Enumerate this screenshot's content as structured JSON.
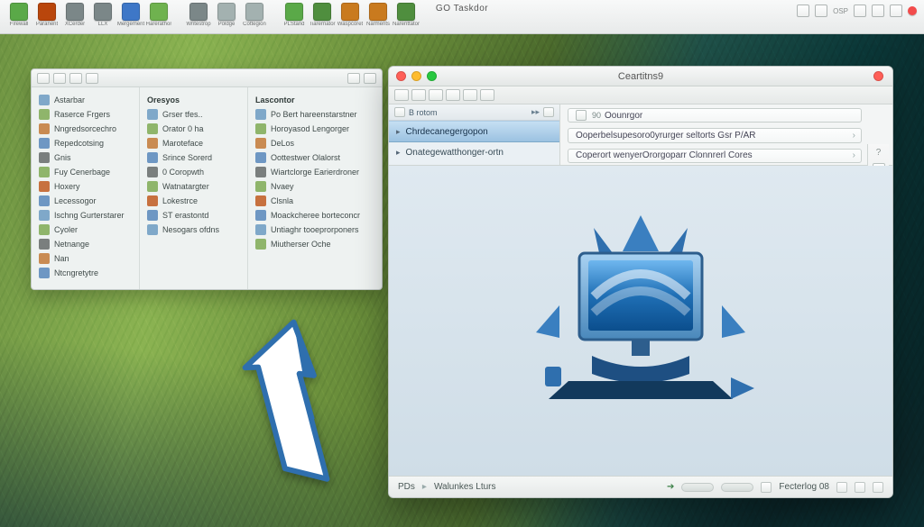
{
  "menubar": {
    "center_title": "GO Taskdor",
    "right_label": "OSP",
    "items": [
      {
        "label": "Firewall",
        "color": "#5aa948"
      },
      {
        "label": "Paranent",
        "color": "#b9460c"
      },
      {
        "label": "XCerder",
        "color": "#7b8788"
      },
      {
        "label": "LLX",
        "color": "#7b8788"
      },
      {
        "label": "Mergement",
        "color": "#3e77c7"
      },
      {
        "label": "Harerathor",
        "color": "#6fb24f"
      },
      {
        "label": "",
        "color": "transparent"
      },
      {
        "label": "Writestrop",
        "color": "#7b8788"
      },
      {
        "label": "Poldge",
        "color": "#a3b1b0"
      },
      {
        "label": "Cottegion",
        "color": "#a3b1b0"
      },
      {
        "label": "",
        "color": "transparent"
      },
      {
        "label": "PLStand",
        "color": "#5aa948"
      },
      {
        "label": "Tiarernator",
        "color": "#4f8e3e"
      },
      {
        "label": "Waspcoret",
        "color": "#c97a1e"
      },
      {
        "label": "Narments",
        "color": "#c97a1e"
      },
      {
        "label": "Narenttator",
        "color": "#4f8e3e"
      }
    ]
  },
  "panel": {
    "sidebar": [
      "Astarbar",
      "Raserce Frgers",
      "Nngredsorcechro",
      "Repedcotsing",
      "Gnis",
      "Fuy Cenerbage",
      "Hoxery",
      "Lecessogor",
      "Ischng Gurterstarer",
      "Cyoler",
      "Netnange",
      "Nan",
      "Ntcngretytre"
    ],
    "col_mid_header": "Oresyos",
    "col_mid": [
      "Grser tfes..",
      "Orator 0 ha",
      "Maroteface",
      "Srince Sorerd",
      "0 Coropwth",
      "Watnatargter",
      "Lokestrce",
      "ST erastontd",
      "Nesogars ofdns"
    ],
    "col_right_header": "Lascontor",
    "col_right": [
      "Po Bert hareenstarstner",
      "Horoyasod Lengorger",
      "DeLos",
      "Oottestwer Olalorst",
      "Wiartclorge Earierdroner",
      "Nvaey",
      "Clsnla",
      "Moackcheree borteconcr",
      "Untiaghr tooeprorponers",
      "Miutherser Oche"
    ]
  },
  "window": {
    "title": "Ceartitns9",
    "left_head": "B rotom",
    "left_selected": "Chrdecanegergopon",
    "left_item": "Onategewatthonger-ortn",
    "field_top_prefix": "90",
    "field_top": "Oounrgor",
    "field_mid": "Ooperbelsupesoro0yrurger seltorts Gsr P/AR",
    "field_bot": "Coperort wenyerOrorgoparr Clonnrerl Cores",
    "status_left": "PDs",
    "status_mid": "Walunkes Lturs",
    "status_right": "Fecterlog  08"
  }
}
